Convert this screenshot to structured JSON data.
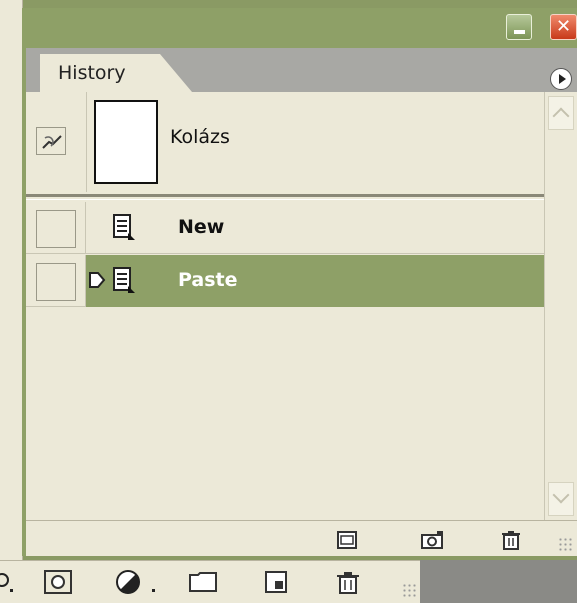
{
  "palette": {
    "tab_label": "History",
    "snapshot": {
      "name": "Kolázs"
    },
    "history_items": [
      {
        "label": "New",
        "icon": "document-icon",
        "active": false
      },
      {
        "label": "Paste",
        "icon": "document-icon",
        "active": true
      }
    ],
    "bottom_icons": [
      "new-document-from-state-icon",
      "create-snapshot-icon",
      "delete-state-icon"
    ],
    "window_buttons": [
      "minimize-icon",
      "close-icon"
    ]
  },
  "toolsbar": {
    "icons": [
      "add-mask-icon",
      "adjustment-layer-icon",
      "new-group-icon",
      "new-layer-icon",
      "delete-layer-icon"
    ]
  },
  "colors": {
    "accent": "#8ea067",
    "panel": "#ece9d8",
    "close": "#d4442a"
  }
}
